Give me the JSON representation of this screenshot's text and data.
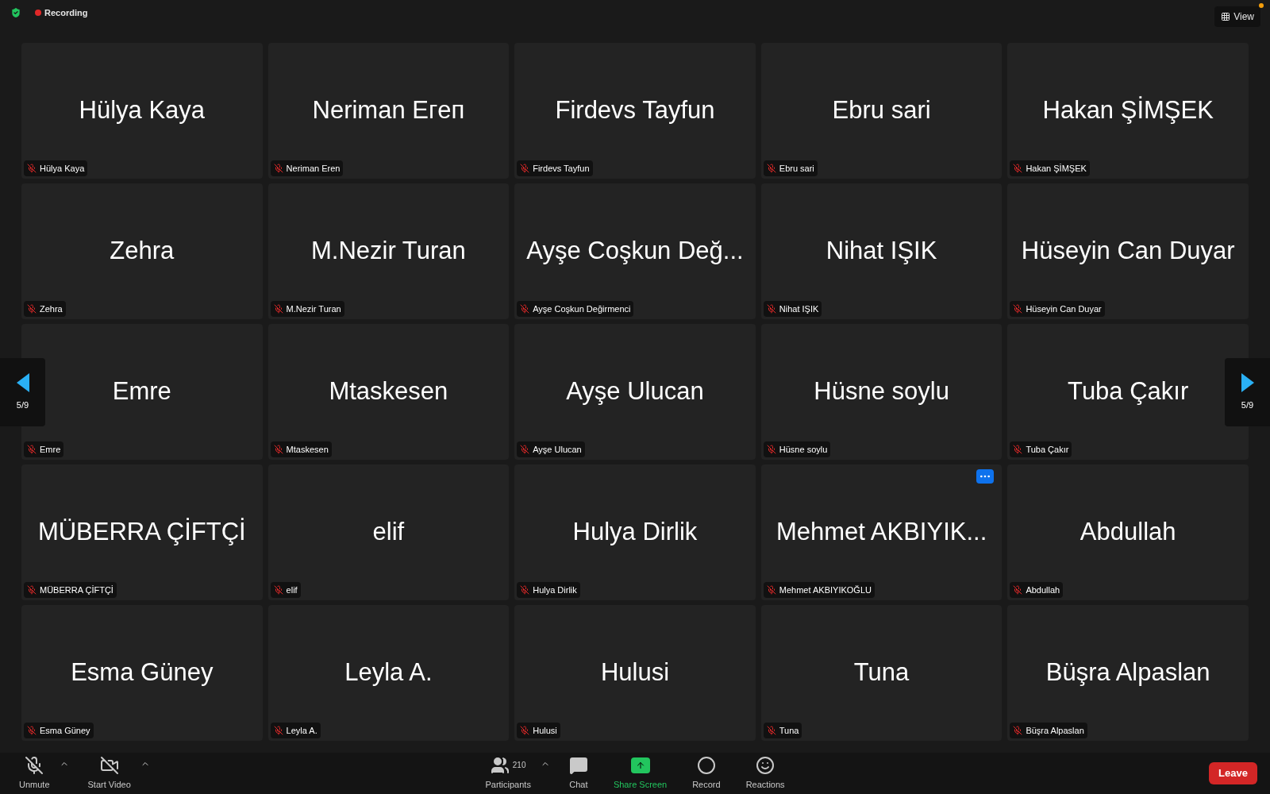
{
  "top_bar": {
    "recording": {
      "label": "Recording",
      "on": true
    },
    "view_button": {
      "label": "View",
      "notification": true
    }
  },
  "pager": {
    "left": "5/9",
    "right": "5/9"
  },
  "tiles": [
    {
      "name": "Hülya Kaya",
      "label": "Hülya Kaya",
      "muted": true,
      "options_shown": false
    },
    {
      "name": "Neriman Eгeп",
      "label": "Neriman Eren",
      "muted": true,
      "options_shown": false
    },
    {
      "name": "Firdevs Tayfun",
      "label": "Firdevs Tayfun",
      "muted": true,
      "options_shown": false
    },
    {
      "name": "Ebru sari",
      "label": "Ebru sari",
      "muted": true,
      "options_shown": false
    },
    {
      "name": "Hakan ŞİMŞEK",
      "label": "Hakan ŞİMŞEK",
      "muted": true,
      "options_shown": false
    },
    {
      "name": "Zehra",
      "label": "Zehra",
      "muted": true,
      "options_shown": false
    },
    {
      "name": "M.Nezir Turan",
      "label": "M.Nezir Turan",
      "muted": true,
      "options_shown": false
    },
    {
      "name": "Ayşe Coşkun Değ...",
      "label": "Ayşe Coşkun Değirmenci",
      "muted": true,
      "options_shown": false
    },
    {
      "name": "Nihat IŞIK",
      "label": "Nihat IŞIK",
      "muted": true,
      "options_shown": false
    },
    {
      "name": "Hüseyin Can Duyar",
      "label": "Hüseyin Can Duyar",
      "muted": true,
      "options_shown": false
    },
    {
      "name": "Emre",
      "label": "Emre",
      "muted": true,
      "options_shown": false
    },
    {
      "name": "Mtaskesen",
      "label": "Mtaskesen",
      "muted": true,
      "options_shown": false
    },
    {
      "name": "Ayşe Ulucan",
      "label": "Ayşe Ulucan",
      "muted": true,
      "options_shown": false
    },
    {
      "name": "Hüsne soylu",
      "label": "Hüsne soylu",
      "muted": true,
      "options_shown": false
    },
    {
      "name": "Tuba Çakır",
      "label": "Tuba Çakır",
      "muted": true,
      "options_shown": false
    },
    {
      "name": "MÜBERRA ÇİFTÇİ",
      "label": "MÜBERRA ÇİFTÇİ",
      "muted": true,
      "options_shown": false
    },
    {
      "name": "elif",
      "label": "elif",
      "muted": true,
      "options_shown": false
    },
    {
      "name": "Hulya Dirlik",
      "label": "Hulya Dirlik",
      "muted": true,
      "options_shown": false
    },
    {
      "name": "Mehmet AKBIYIK...",
      "label": "Mehmet AKBIYIKOĞLU",
      "muted": true,
      "options_shown": true
    },
    {
      "name": "Abdullah",
      "label": "Abdullah",
      "muted": true,
      "options_shown": false
    },
    {
      "name": "Esma Güney",
      "label": "Esma Güney",
      "muted": true,
      "options_shown": false
    },
    {
      "name": "Leyla A.",
      "label": "Leyla A.",
      "muted": true,
      "options_shown": false
    },
    {
      "name": "Hulusi",
      "label": "Hulusi",
      "muted": true,
      "options_shown": false
    },
    {
      "name": "Tuna",
      "label": "Tuna",
      "muted": true,
      "options_shown": false
    },
    {
      "name": "Büşra Alpaslan",
      "label": "Büşra Alpaslan",
      "muted": true,
      "options_shown": false
    }
  ],
  "toolbar": {
    "left": [
      {
        "kind": "unmute",
        "label": "Unmute"
      },
      {
        "kind": "video",
        "label": "Start Video"
      }
    ],
    "center": [
      {
        "kind": "participants",
        "label": "Participants",
        "count": "210"
      },
      {
        "kind": "chat",
        "label": "Chat"
      },
      {
        "kind": "share",
        "label": "Share Screen"
      },
      {
        "kind": "record",
        "label": "Record"
      },
      {
        "kind": "reactions",
        "label": "Reactions"
      }
    ],
    "leave": "Leave"
  }
}
